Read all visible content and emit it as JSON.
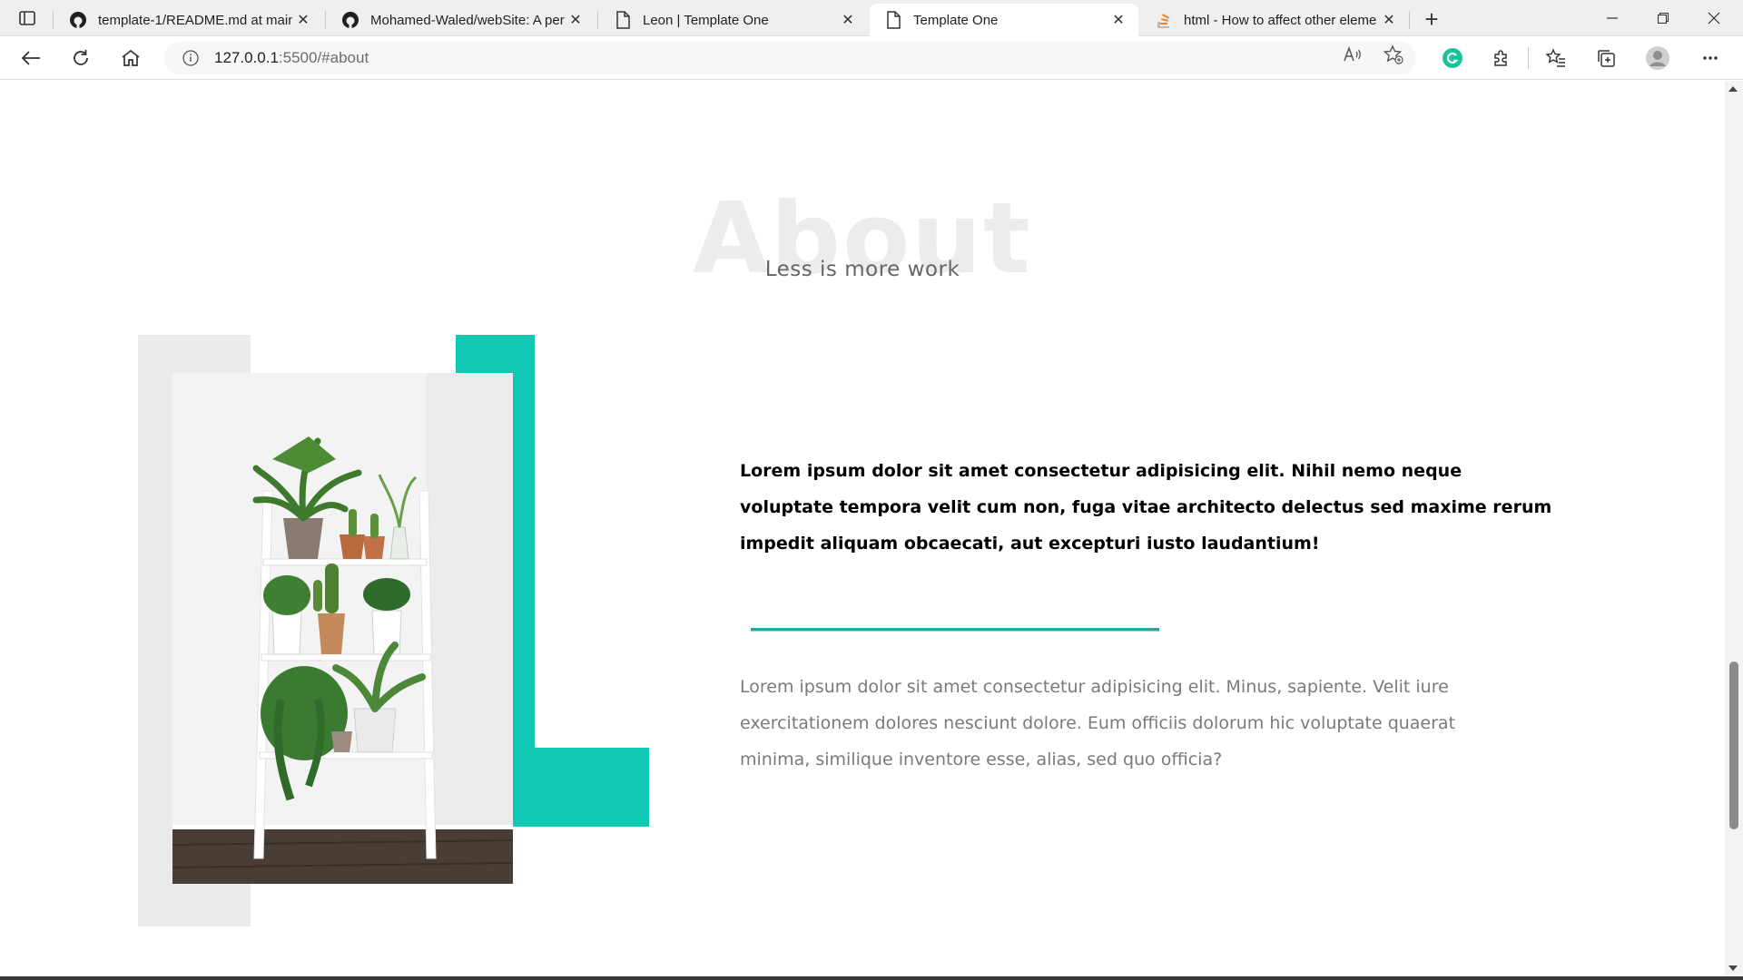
{
  "browser": {
    "tabs": [
      {
        "title": "template-1/README.md at main",
        "favicon": "github-icon",
        "active": false
      },
      {
        "title": "Mohamed-Waled/webSite: A per",
        "favicon": "github-icon",
        "active": false
      },
      {
        "title": "Leon | Template One",
        "favicon": "page-icon",
        "active": false
      },
      {
        "title": "Template One",
        "favicon": "page-icon",
        "active": true
      },
      {
        "title": "html - How to affect other eleme",
        "favicon": "stackoverflow-icon",
        "active": false
      }
    ],
    "address": {
      "host": "127.0.0.1",
      "rest": ":5500/#about"
    }
  },
  "about": {
    "heading": "About",
    "subheading": "Less is more work",
    "lead": "Lorem ipsum dolor sit amet consectetur adipisicing elit. Nihil nemo neque voluptate tempora velit cum non, fuga vitae architecto delectus sed maxime rerum impedit aliquam obcaecati, aut excepturi iusto laudantium!",
    "body": "Lorem ipsum dolor sit amet consectetur adipisicing elit. Minus, sapiente. Velit iure exercitationem dolores nesciunt dolore. Eum officiis dolorum hic voluptate quaerat minima, similique inventore esse, alias, sed quo officia?"
  },
  "colors": {
    "accent": "#12c7b3",
    "block_grey": "#ebebeb",
    "heading_watermark": "#ececec",
    "body_text": "#7a7a7a"
  }
}
